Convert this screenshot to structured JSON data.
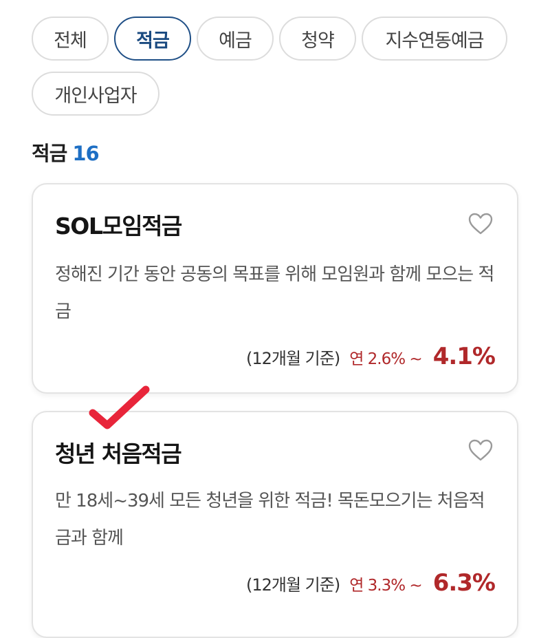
{
  "filters": {
    "chips": [
      {
        "label": "전체",
        "active": false
      },
      {
        "label": "적금",
        "active": true
      },
      {
        "label": "예금",
        "active": false
      },
      {
        "label": "청약",
        "active": false
      },
      {
        "label": "지수연동예금",
        "active": false
      },
      {
        "label": "개인사업자",
        "active": false
      }
    ]
  },
  "section": {
    "title": "적금",
    "count": "16"
  },
  "products": [
    {
      "name": "SOL모임적금",
      "description": "정해진 기간 동안 공동의 목표를 위해 모임원과 함께 모으는 적금",
      "basis": "(12개월 기준)",
      "range": "연 2.6% ~",
      "max_rate": "4.1%",
      "favorite_icon": "heart-outline-icon"
    },
    {
      "name": "청년 처음적금",
      "description": "만 18세~39세 모든 청년을 위한 적금! 목돈모으기는 처음적금과 함께",
      "basis": "(12개월 기준)",
      "range": "연 3.3% ~",
      "max_rate": "6.3%",
      "favorite_icon": "heart-outline-icon"
    }
  ],
  "colors": {
    "active_chip": "#1f4f86",
    "count_accent": "#1e6fc4",
    "rate_red": "#b0282a",
    "checkmark": "#e8253a"
  }
}
